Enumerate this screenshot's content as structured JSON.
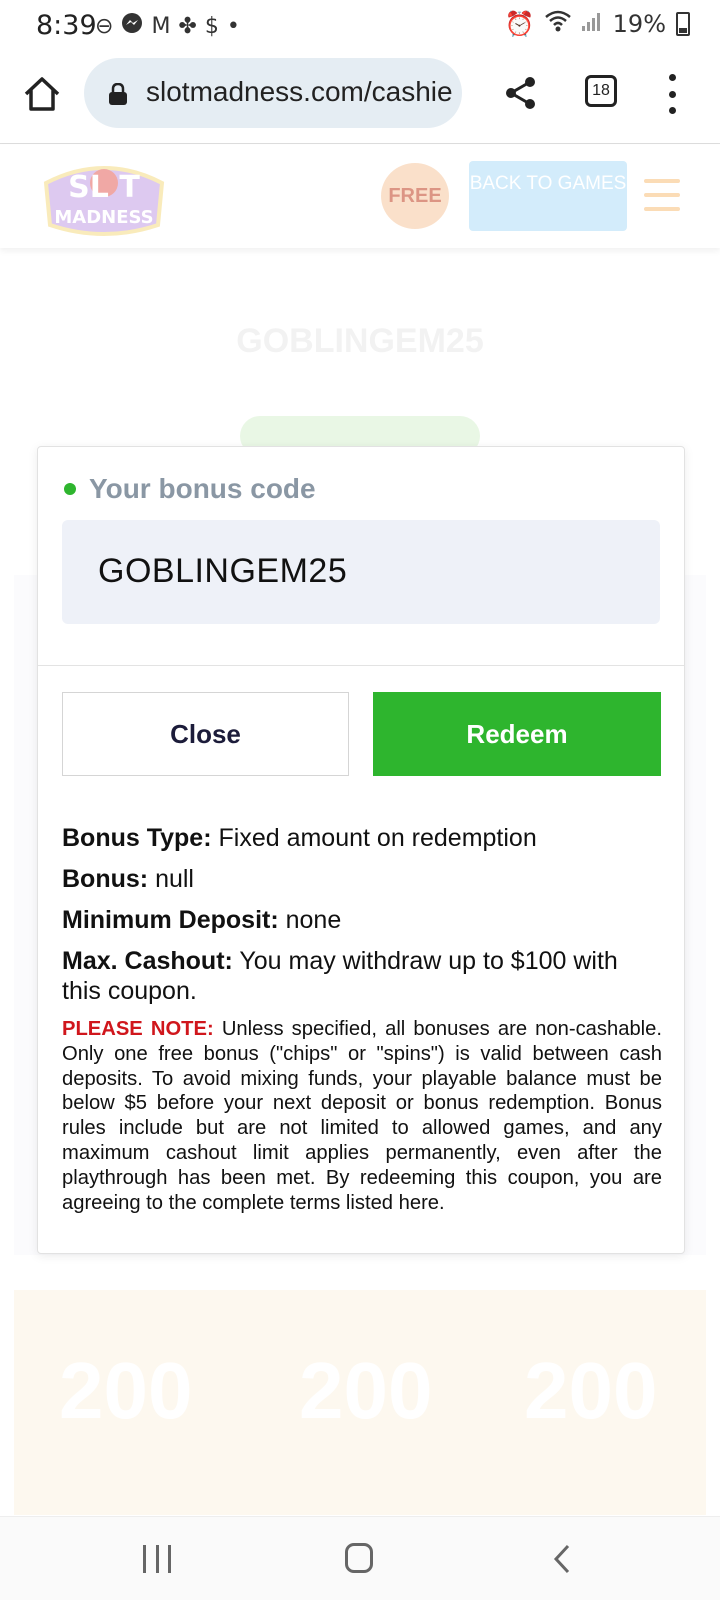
{
  "status_bar": {
    "time": "8:39",
    "left_icons": [
      "⊖",
      "messenger-icon",
      "M",
      "✤",
      "$",
      "•"
    ],
    "battery": "19%"
  },
  "browser": {
    "url": "slotmadness.com/cashie",
    "tab_count": "18"
  },
  "site_header": {
    "logo_text": "SLOT MADNESS",
    "free_badge": "FREE",
    "back_button": "BACK TO GAMES"
  },
  "background": {
    "code_text": "GOBLINGEM25",
    "prize_values": [
      "200",
      "200",
      "200"
    ]
  },
  "modal": {
    "title": "Your bonus code",
    "code": "GOBLINGEM25",
    "close_label": "Close",
    "redeem_label": "Redeem",
    "details": [
      {
        "label": "Bonus Type:",
        "value": "Fixed amount on redemption"
      },
      {
        "label": "Bonus:",
        "value": "null"
      },
      {
        "label": "Minimum Deposit:",
        "value": "none"
      },
      {
        "label": "Max. Cashout:",
        "value": "You may withdraw up to $100 with this coupon."
      }
    ],
    "note_label": "PLEASE NOTE:",
    "note_text": "Unless specified, all bonuses are non-cashable. Only one free bonus (\"chips\" or \"spins\") is valid between cash deposits. To avoid mixing funds, your playable balance must be below $5 before your next deposit or bonus redemption. Bonus rules include but are not limited to allowed games, and any maximum cashout limit applies permanently, even after the playthrough has been met. By redeeming this coupon, you are agreeing to the complete terms listed here."
  },
  "colors": {
    "redeem_green": "#2eb52e",
    "note_red": "#d0161c",
    "code_box_bg": "#eef1f8",
    "url_pill_bg": "#e5edf3"
  }
}
